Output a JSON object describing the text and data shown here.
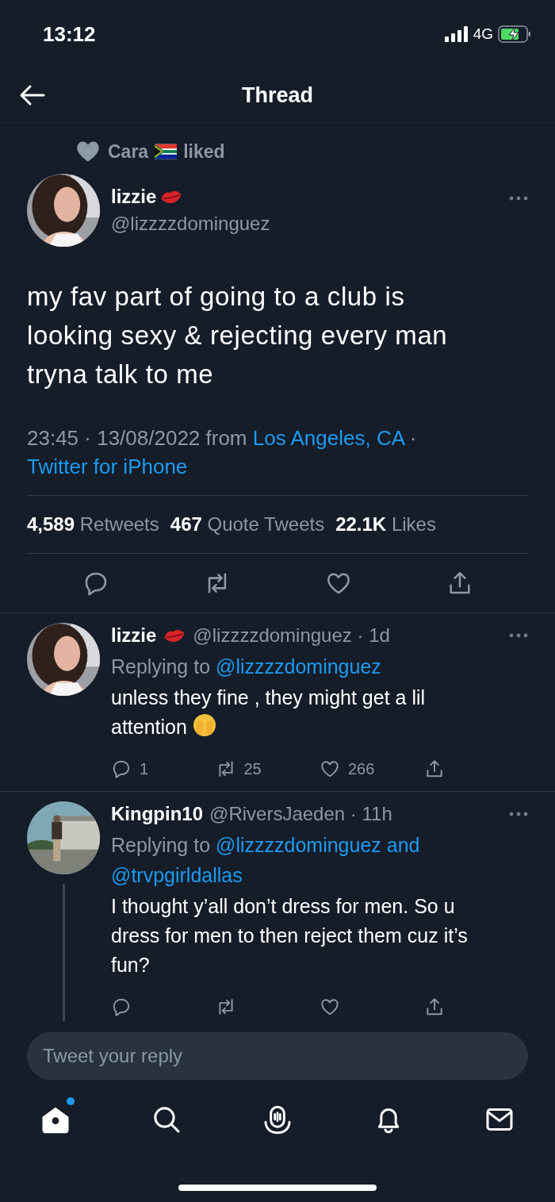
{
  "status_bar": {
    "time": "13:12",
    "network": "4G"
  },
  "header": {
    "title": "Thread"
  },
  "social_context": {
    "name": "Cara",
    "action": "liked"
  },
  "tweet": {
    "author": {
      "name": "lizzie",
      "handle": "@lizzzzdominguez"
    },
    "text": "my fav part of going to a club is looking sexy & rejecting every man tryna talk to me",
    "timestamp": "23:45 · 13/08/2022",
    "from": "from",
    "location": "Los Angeles, CA",
    "separator": "·",
    "source": "Twitter for iPhone",
    "stats": [
      {
        "count": "4,589",
        "label": "Retweets"
      },
      {
        "count": "467",
        "label": "Quote Tweets"
      },
      {
        "count": "22.1K",
        "label": "Likes"
      }
    ]
  },
  "replies": [
    {
      "name": "lizzie",
      "handle": "@lizzzzdominguez",
      "separator": "·",
      "age": "1d",
      "replying_label": "Replying to",
      "mentions": [
        "@lizzzzdominguez"
      ],
      "text": "unless they fine , they might get a lil attention",
      "counts": {
        "reply": "1",
        "retweet": "25",
        "like": "266"
      },
      "thread_line": false
    },
    {
      "name": "Kingpin10",
      "handle": "@RiversJaeden",
      "separator": "·",
      "age": "11h",
      "replying_label": "Replying to",
      "mentions": [
        "@lizzzzdominguez",
        "@trvpgirldallas"
      ],
      "conjunction": "and",
      "text": "I thought y’all don’t dress for men. So u dress for men to then reject them cuz it’s fun?",
      "thread_line": true
    }
  ],
  "composer": {
    "placeholder": "Tweet your reply"
  },
  "tab_bar": [
    {
      "kind": "home",
      "selected": true,
      "badge": true
    },
    {
      "kind": "search",
      "selected": false,
      "badge": false
    },
    {
      "kind": "spaces",
      "selected": false,
      "badge": false
    },
    {
      "kind": "notifications",
      "selected": false,
      "badge": false
    },
    {
      "kind": "messages",
      "selected": false,
      "badge": false
    }
  ]
}
